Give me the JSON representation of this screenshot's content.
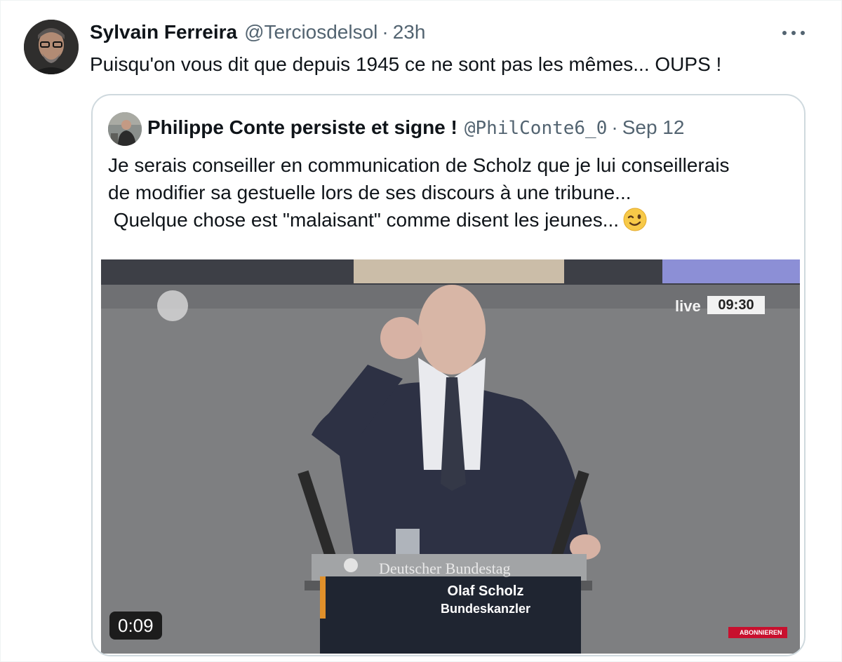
{
  "tweet": {
    "author_name": "Sylvain Ferreira",
    "author_handle": "@Terciosdelsol",
    "separator": "·",
    "timestamp": "23h",
    "text": "Puisqu'on vous dit que depuis 1945 ce ne sont pas les mêmes... OUPS !",
    "more_icon": "more-horizontal-icon"
  },
  "quoted_tweet": {
    "author_name": "Philippe Conte persiste et signe !",
    "author_handle": "@PhilConte6_0",
    "separator": "·",
    "timestamp": "Sep 12",
    "text_lines": [
      "Je serais conseiller en communication de Scholz que je lui conseillerais",
      "de modifier sa gestuelle lors de ses discours à une tribune...",
      " Quelque chose est \"malaisant\" comme disent les jeunes..."
    ],
    "emoji": "winking-face-emoji",
    "video": {
      "duration": "0:09",
      "live_label": "live",
      "clock": "09:30",
      "podium_text": "Deutscher Bundestag",
      "lower_third_name": "Olaf Scholz",
      "lower_third_title": "Bundeskanzler",
      "subscribe_badge": "ABONNIEREN"
    }
  },
  "colors": {
    "text_primary": "#0f1419",
    "text_secondary": "#536471",
    "card_border": "#cfd9de"
  }
}
